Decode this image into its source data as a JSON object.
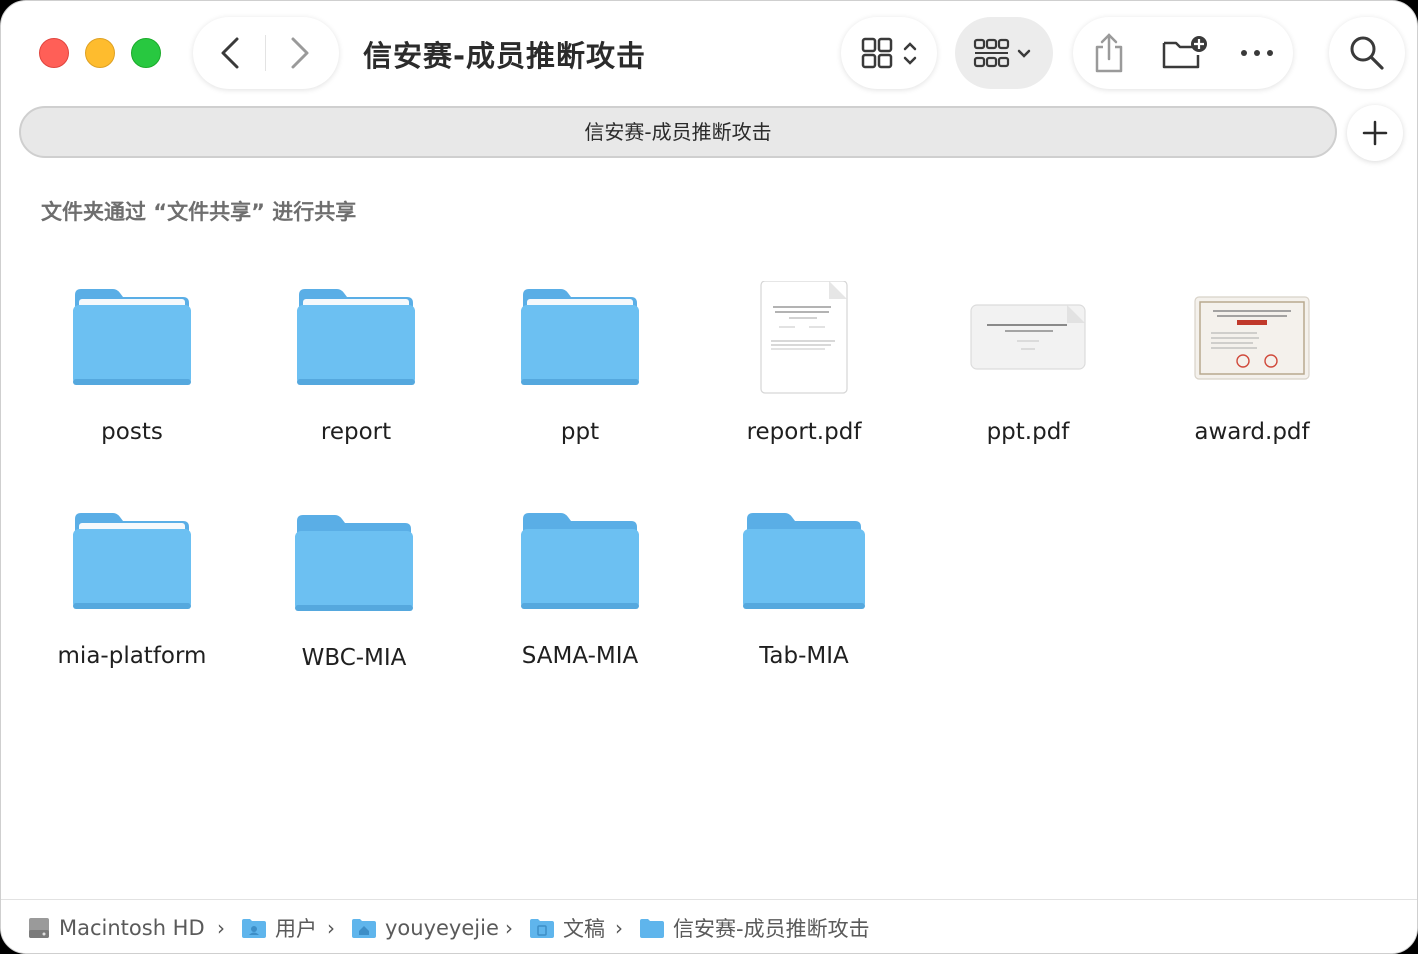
{
  "window": {
    "title": "信安赛-成员推断攻击"
  },
  "tab": {
    "label": "信安赛-成员推断攻击",
    "add_label": "+"
  },
  "shared_notice": "文件夹通过 “文件共享” 进行共享",
  "items": [
    {
      "name": "posts",
      "kind": "folder"
    },
    {
      "name": "report",
      "kind": "folder"
    },
    {
      "name": "ppt",
      "kind": "folder"
    },
    {
      "name": "report.pdf",
      "kind": "pdf-document"
    },
    {
      "name": "ppt.pdf",
      "kind": "pdf-slide"
    },
    {
      "name": "award.pdf",
      "kind": "pdf-certificate"
    },
    {
      "name": "mia-platform",
      "kind": "folder"
    },
    {
      "name": "WBC-MIA",
      "kind": "folder"
    },
    {
      "name": "SAMA-MIA",
      "kind": "folder"
    },
    {
      "name": "Tab-MIA",
      "kind": "folder"
    }
  ],
  "path": [
    {
      "label": "Macintosh HD",
      "icon": "hard-drive-icon"
    },
    {
      "label": "用户",
      "icon": "users-folder-icon"
    },
    {
      "label": "youyeyejie",
      "icon": "home-folder-icon"
    },
    {
      "label": "文稿",
      "icon": "documents-folder-icon"
    },
    {
      "label": "信安赛-成员推断攻击",
      "icon": "folder-icon"
    }
  ],
  "path_separator": "›",
  "colors": {
    "folder_top": "#5db3ea",
    "folder_body": "#6cc0f2",
    "close": "#ff5f57",
    "minimize": "#febc2e",
    "maximize": "#28c840"
  }
}
